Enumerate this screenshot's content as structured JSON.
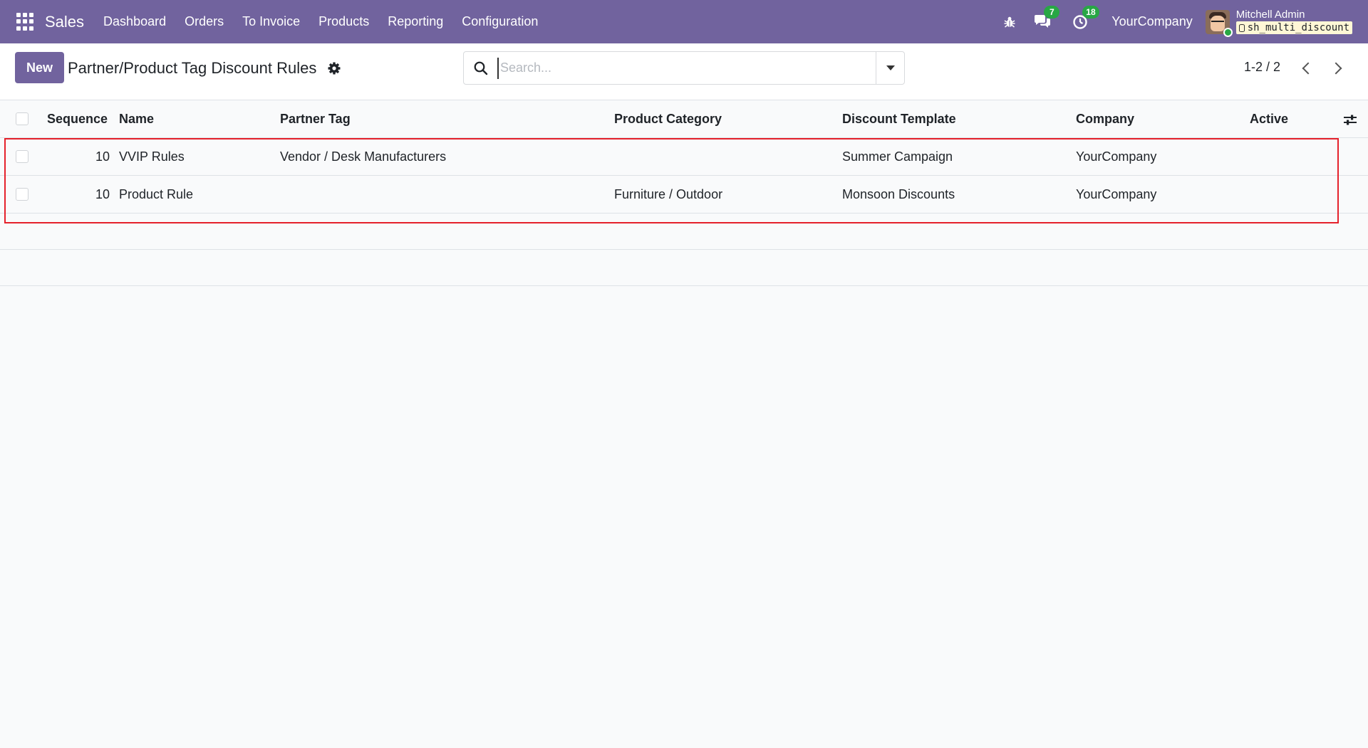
{
  "navbar": {
    "app_name": "Sales",
    "menu": [
      "Dashboard",
      "Orders",
      "To Invoice",
      "Products",
      "Reporting",
      "Configuration"
    ],
    "messages_count": "7",
    "activities_count": "18",
    "company": "YourCompany",
    "user_name": "Mitchell Admin",
    "database": "sh_multi_discount",
    "icons": [
      "apps-grid-icon",
      "bug-icon",
      "chat-icon",
      "clock-icon"
    ],
    "accent_color": "#71639e"
  },
  "control": {
    "new_label": "New",
    "title": "Partner/Product Tag Discount Rules",
    "search_placeholder": "Search...",
    "pager": "1-2 / 2"
  },
  "table": {
    "columns": [
      "Sequence",
      "Name",
      "Partner Tag",
      "Product Category",
      "Discount Template",
      "Company",
      "Active"
    ],
    "rows": [
      {
        "sequence": "10",
        "name": "VVIP Rules",
        "partner_tag": "Vendor / Desk Manufacturers",
        "product_category": "",
        "discount_template": "Summer Campaign",
        "company": "YourCompany",
        "active": ""
      },
      {
        "sequence": "10",
        "name": "Product Rule",
        "partner_tag": "",
        "product_category": "Furniture / Outdoor",
        "discount_template": "Monsoon Discounts",
        "company": "YourCompany",
        "active": ""
      }
    ]
  },
  "highlight_color": "#e5212b"
}
